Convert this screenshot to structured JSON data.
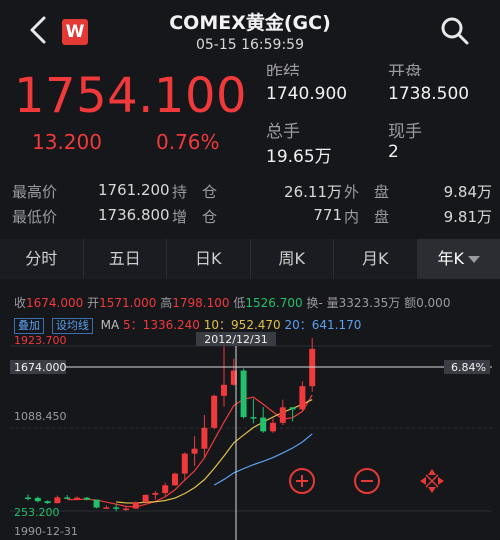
{
  "header": {
    "title": "COMEX黄金(GC)",
    "subtitle": "05-15 16:59:59",
    "logo_letter": "W"
  },
  "quote": {
    "price": "1754.100",
    "change": "13.200",
    "change_pct": "0.76%",
    "prev_close_label": "昨结",
    "prev_close": "1740.900",
    "open_label": "开盘",
    "open": "1738.500",
    "volume_label": "总手",
    "volume": "19.65万",
    "current_label": "现手",
    "current": "2",
    "rows": [
      {
        "k1": "最高价",
        "v1": "1761.200",
        "k2": "持　仓",
        "v2": "26.11万",
        "k3": "外　盘",
        "v3": "9.84万"
      },
      {
        "k1": "最低价",
        "v1": "1736.800",
        "k2": "增　仓",
        "v2": "771",
        "k3": "内　盘",
        "v3": "9.81万"
      }
    ],
    "color_up": "#f0393a",
    "color_down": "#21c16b"
  },
  "tabs": [
    "分时",
    "五日",
    "日K",
    "周K",
    "月K",
    "年K"
  ],
  "ohlc": {
    "close_label": "收",
    "close": "1674.000",
    "open_label": "开",
    "open": "1571.000",
    "high_label": "高",
    "high": "1798.100",
    "low_label": "低",
    "low": "1526.700",
    "turnover_label": "换-",
    "volume_label": "量",
    "volume": "3323.35万",
    "amount_label": "额",
    "amount": "0.000"
  },
  "ma_bar": {
    "btn_overlay": "叠加",
    "btn_settings": "设均线",
    "ma_label": "MA",
    "ma5": "5：1336.240",
    "ma10": "10：952.470",
    "ma20": "20：641.170"
  },
  "chart_data": {
    "type": "candlestick",
    "y_top_label": "1923.700",
    "y_mid_label": "1088.450",
    "y_bottom_label": "253.200",
    "crosshair_value": "1674.000",
    "crosshair_pct": "6.84%",
    "crosshair_date": "2012/12/31",
    "x_start_label": "1990-12-31",
    "ylim": [
      253.2,
      1923.7
    ],
    "candles": [
      {
        "o": 390,
        "c": 386,
        "h": 420,
        "l": 360
      },
      {
        "o": 386,
        "c": 353,
        "h": 400,
        "l": 340
      },
      {
        "o": 353,
        "c": 333,
        "h": 360,
        "l": 325
      },
      {
        "o": 333,
        "c": 391,
        "h": 410,
        "l": 330
      },
      {
        "o": 391,
        "c": 383,
        "h": 415,
        "l": 375
      },
      {
        "o": 383,
        "c": 388,
        "h": 400,
        "l": 370
      },
      {
        "o": 388,
        "c": 368,
        "h": 395,
        "l": 360
      },
      {
        "o": 368,
        "c": 288,
        "h": 370,
        "l": 280
      },
      {
        "o": 288,
        "c": 290,
        "h": 310,
        "l": 275
      },
      {
        "o": 290,
        "c": 275,
        "h": 330,
        "l": 252
      },
      {
        "o": 275,
        "c": 278,
        "h": 295,
        "l": 255
      },
      {
        "o": 278,
        "c": 343,
        "h": 350,
        "l": 275
      },
      {
        "o": 343,
        "c": 417,
        "h": 420,
        "l": 320
      },
      {
        "o": 417,
        "c": 435,
        "h": 455,
        "l": 370
      },
      {
        "o": 435,
        "c": 513,
        "h": 540,
        "l": 410
      },
      {
        "o": 513,
        "c": 632,
        "h": 640,
        "l": 510
      },
      {
        "o": 632,
        "c": 834,
        "h": 845,
        "l": 560
      },
      {
        "o": 834,
        "c": 884,
        "h": 1010,
        "l": 710
      },
      {
        "o": 884,
        "c": 1095,
        "h": 1225,
        "l": 800
      },
      {
        "o": 1095,
        "c": 1420,
        "h": 1430,
        "l": 1080
      },
      {
        "o": 1420,
        "c": 1531,
        "h": 1920,
        "l": 1310
      },
      {
        "o": 1531,
        "c": 1675,
        "h": 1795,
        "l": 1520
      },
      {
        "o": 1675,
        "c": 1204,
        "h": 1695,
        "l": 1190
      },
      {
        "o": 1204,
        "c": 1199,
        "h": 1390,
        "l": 1140
      },
      {
        "o": 1199,
        "c": 1060,
        "h": 1305,
        "l": 1045
      },
      {
        "o": 1060,
        "c": 1146,
        "h": 1190,
        "l": 1045
      },
      {
        "o": 1146,
        "c": 1303,
        "h": 1380,
        "l": 1125
      },
      {
        "o": 1303,
        "c": 1282,
        "h": 1305,
        "l": 1160
      },
      {
        "o": 1282,
        "c": 1517,
        "h": 1566,
        "l": 1267
      },
      {
        "o": 1517,
        "c": 1895,
        "h": 2075,
        "l": 1460
      }
    ],
    "ma5_color": "#f0393a",
    "ma10_color": "#e0c04a",
    "ma20_color": "#5aa0f0"
  }
}
